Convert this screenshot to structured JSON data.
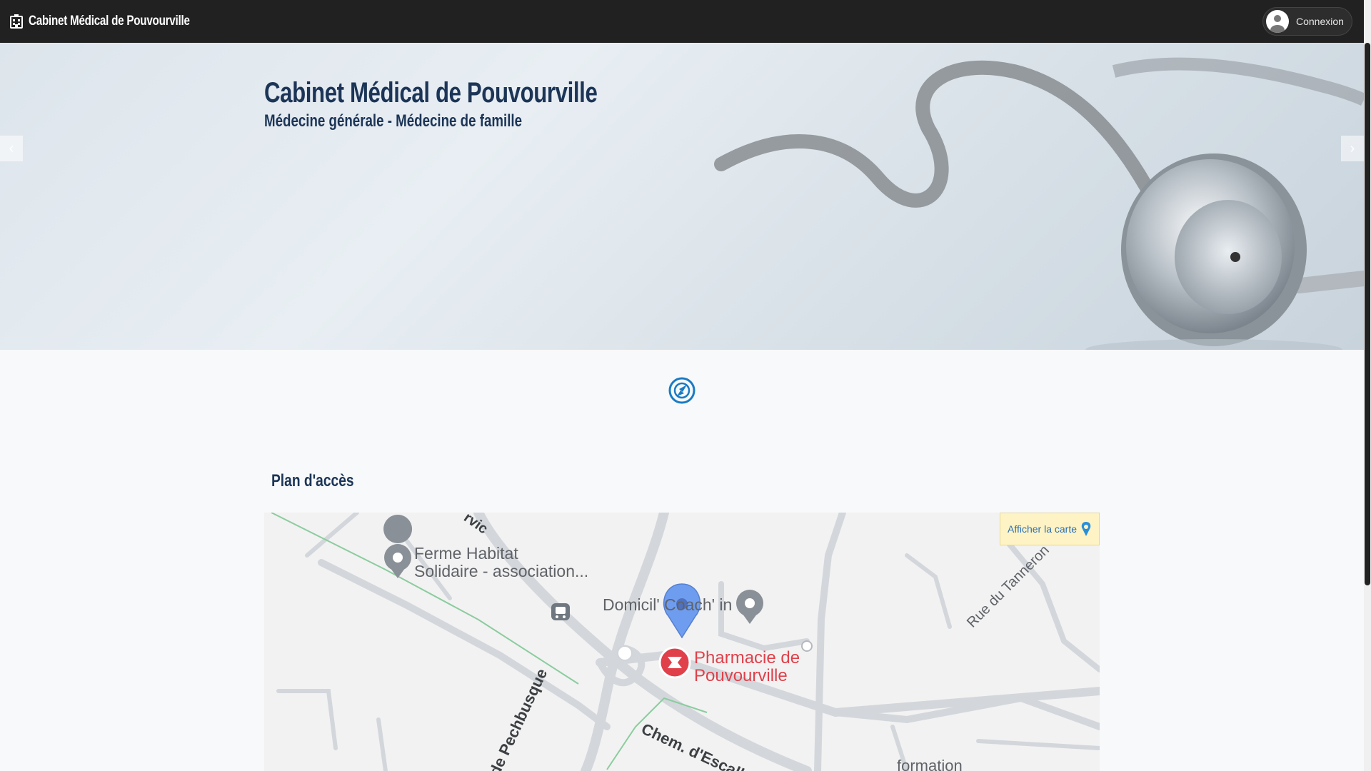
{
  "navbar": {
    "brand": "Cabinet Médical de Pouvourville",
    "login_label": "Connexion"
  },
  "hero": {
    "title": "Cabinet Médical de Pouvourville",
    "subtitle": "Médecine générale - Médecine de famille",
    "prev_label": "‹",
    "next_label": "›"
  },
  "access": {
    "title": "Plan d'accès",
    "show_map_label": "Afficher la carte"
  },
  "map": {
    "poi_1": "Ferme Habitat",
    "poi_1b": "Solidaire - association...",
    "poi_2": "Domicil' Coach' in",
    "poi_3": "Pharmacie de",
    "poi_3b": "Pouvourville",
    "street_1": "Rue du Tanneron",
    "street_2": "Chem. d'Escall",
    "street_3": "de Pechbusque",
    "street_4": "rvic",
    "poi_4": "formation"
  },
  "colors": {
    "navbar": "#212121",
    "title": "#1c3557",
    "link": "#2a6fb5",
    "pharmacy": "#e0404a",
    "pin": "#6e9df0"
  }
}
